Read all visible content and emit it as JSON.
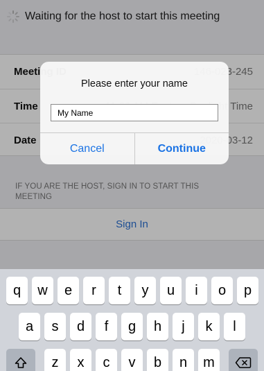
{
  "header": {
    "title": "Waiting for the host to start this meeting"
  },
  "meeting_info": [
    {
      "label": "Meeting ID",
      "value": "146-023-245"
    },
    {
      "label": "Time",
      "value": "11:30 AM Eastern Daylight Time"
    },
    {
      "label": "Date",
      "value": "2020-03-12"
    }
  ],
  "host_note": "IF YOU ARE THE HOST, SIGN IN TO START THIS MEETING",
  "sign_in": {
    "label": "Sign In"
  },
  "dialog": {
    "title": "Please enter your name",
    "input_value": "My Name",
    "cancel_label": "Cancel",
    "continue_label": "Continue"
  },
  "keyboard": {
    "row1": [
      "q",
      "w",
      "e",
      "r",
      "t",
      "y",
      "u",
      "i",
      "o",
      "p"
    ],
    "row2": [
      "a",
      "s",
      "d",
      "f",
      "g",
      "h",
      "j",
      "k",
      "l"
    ],
    "row3": [
      "z",
      "x",
      "c",
      "v",
      "b",
      "n",
      "m"
    ],
    "shift_icon": "shift-icon",
    "delete_icon": "delete-icon"
  },
  "colors": {
    "accent": "#1b73e4",
    "link": "#2a70d3",
    "background": "#efeff4"
  }
}
